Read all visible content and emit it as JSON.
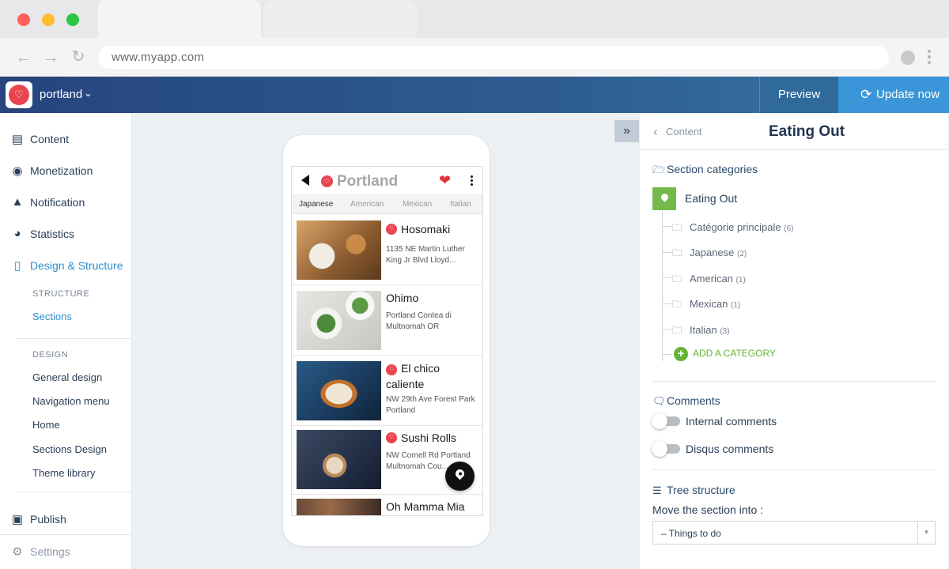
{
  "browser": {
    "url": "www.myapp.com"
  },
  "header": {
    "app_name": "portland",
    "preview_label": "Preview",
    "update_label": "Update now"
  },
  "sidebar": {
    "items": [
      {
        "label": "Content",
        "icon": "document-icon"
      },
      {
        "label": "Monetization",
        "icon": "dollar-icon"
      },
      {
        "label": "Notification",
        "icon": "bell-icon"
      },
      {
        "label": "Statistics",
        "icon": "pie-chart-icon"
      },
      {
        "label": "Design & Structure",
        "icon": "mobile-icon"
      }
    ],
    "structure_heading": "STRUCTURE",
    "structure_items": [
      "Sections"
    ],
    "design_heading": "DESIGN",
    "design_items": [
      "General design",
      "Navigation menu",
      "Home",
      "Sections Design",
      "Theme library"
    ],
    "publish_label": "Publish",
    "settings_label": "Settings"
  },
  "phone": {
    "title": "Portland",
    "tabs": [
      "Japanese",
      "American",
      "Mexican",
      "Italian"
    ],
    "items": [
      {
        "name": "Hosomaki",
        "address": "1135 NE Martin Luther King Jr Blvd Lloyd..."
      },
      {
        "name": "Ohimo",
        "address": "Portland Contea di Multnomah OR"
      },
      {
        "name": "El chico caliente",
        "address": "NW 29th Ave Forest Park Portland"
      },
      {
        "name": "Sushi Rolls",
        "address": "NW Cornell Rd Portland Multnomah Cou..."
      },
      {
        "name": "Oh Mamma Mia",
        "address": ""
      }
    ]
  },
  "panel": {
    "back_label": "Content",
    "title": "Eating Out",
    "section_categories_label": "Section categories",
    "root_category": "Eating Out",
    "categories": [
      {
        "label": "Catégorie principale",
        "count": "(6)"
      },
      {
        "label": "Japanese",
        "count": "(2)"
      },
      {
        "label": "American",
        "count": "(1)"
      },
      {
        "label": "Mexican",
        "count": "(1)"
      },
      {
        "label": "Italian",
        "count": "(3)"
      }
    ],
    "add_category_label": "ADD A CATEGORY",
    "comments_label": "Comments",
    "internal_comments_label": "Internal comments",
    "disqus_comments_label": "Disqus comments",
    "tree_structure_label": "Tree structure",
    "move_label": "Move the section into :",
    "move_value": "– Things to do"
  }
}
